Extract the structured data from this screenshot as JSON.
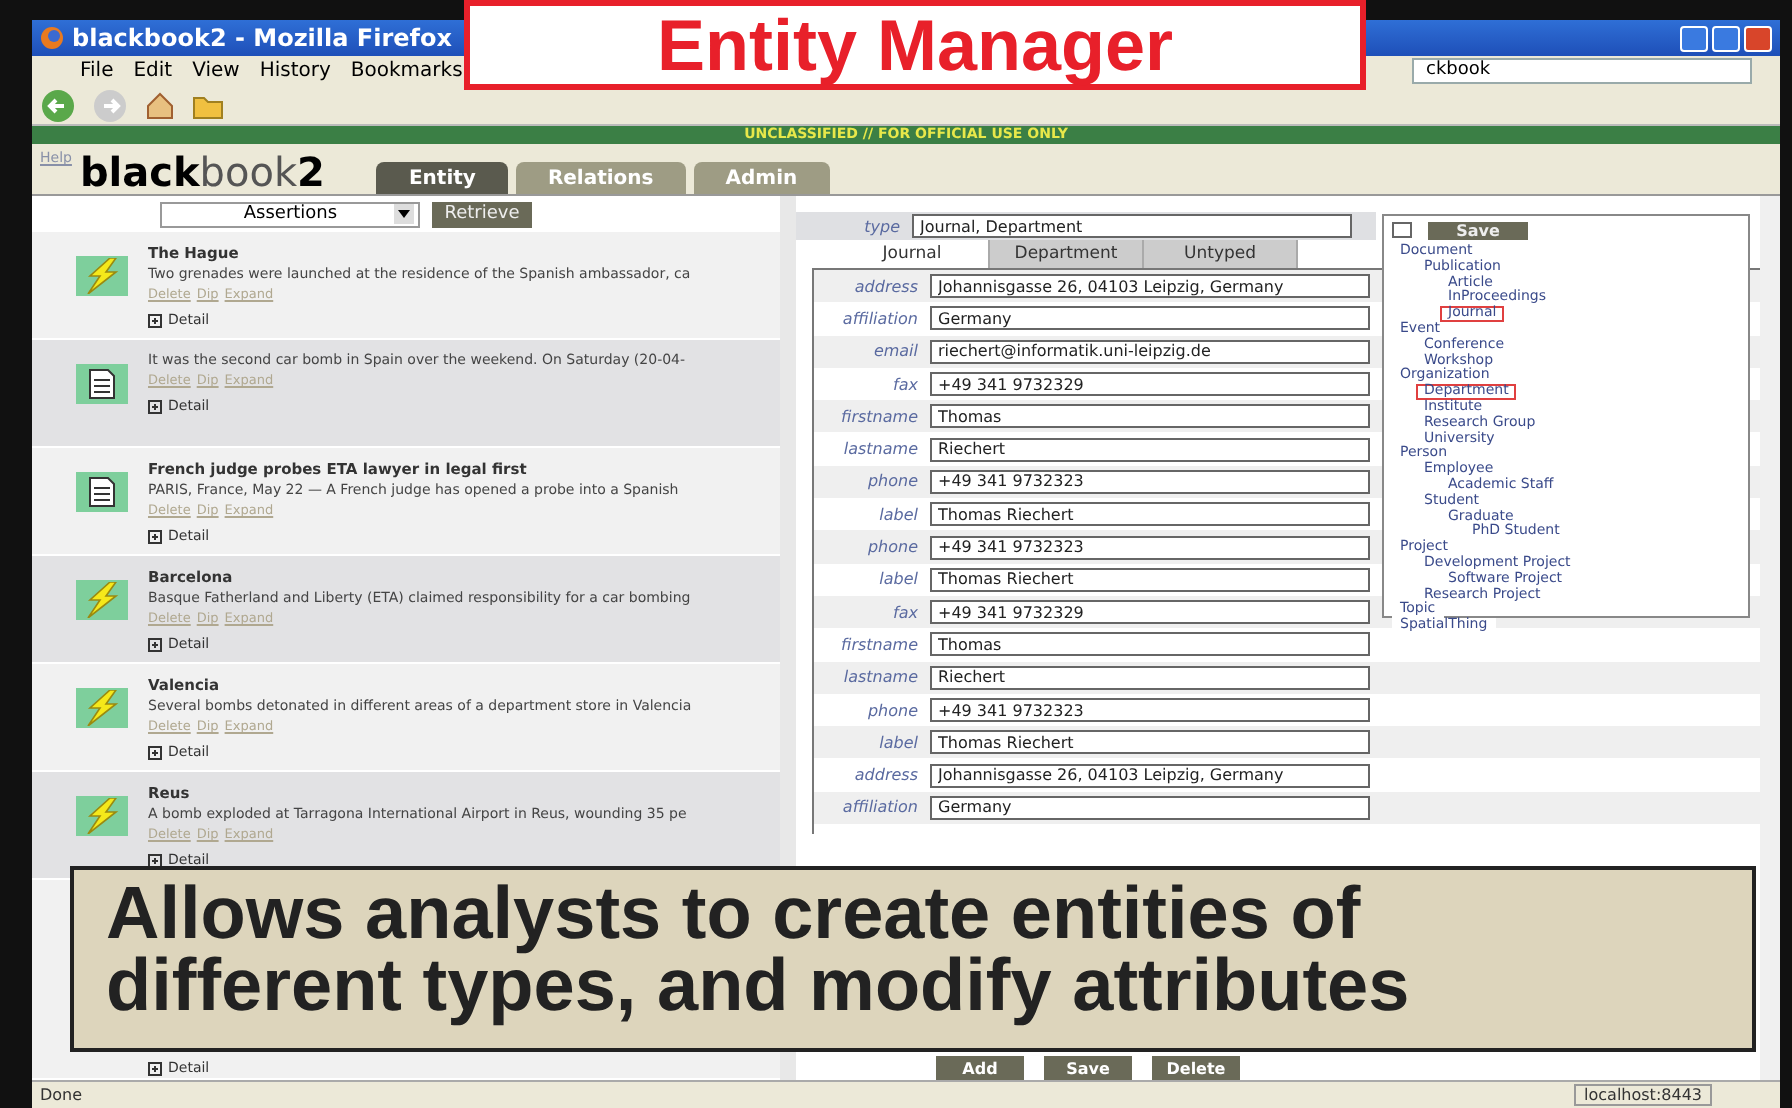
{
  "callout_title": "Entity Manager",
  "caption": "Allows analysts to create entities of different types, and modify attributes",
  "window": {
    "title": "blackbook2 - Mozilla Firefox"
  },
  "menu": [
    "File",
    "Edit",
    "View",
    "History",
    "Bookmarks"
  ],
  "address": "ckbook",
  "banner": "UNCLASSIFIED // FOR OFFICIAL USE ONLY",
  "app": {
    "help": "Help",
    "logo_bold": "black",
    "logo_light": "book",
    "logo_num": "2"
  },
  "tabs": [
    {
      "label": "Entity",
      "selected": true
    },
    {
      "label": "Relations",
      "selected": false
    },
    {
      "label": "Admin",
      "selected": false
    }
  ],
  "assertions": {
    "select": "Assertions",
    "button": "Retrieve",
    "items": [
      {
        "kind": "event",
        "title": "The Hague",
        "text": "Two grenades were launched at the residence of the Spanish ambassador, ca",
        "links": [
          "Delete",
          "Dip",
          "Expand"
        ],
        "detail": "Detail"
      },
      {
        "kind": "document",
        "text": "It was the second car bomb in Spain over the weekend. On Saturday (20-04-",
        "links": [
          "Delete",
          "Dip",
          "Expand"
        ],
        "detail": "Detail"
      },
      {
        "kind": "document",
        "title": "French judge probes ETA lawyer in legal first",
        "text": "PARIS, France, May 22 — A French judge has opened a probe into a Spanish",
        "links": [
          "Delete",
          "Dip",
          "Expand"
        ],
        "detail": "Detail"
      },
      {
        "kind": "event",
        "title": "Barcelona",
        "text": "Basque Fatherland and Liberty (ETA) claimed responsibility for a car bombing",
        "links": [
          "Delete",
          "Dip",
          "Expand"
        ],
        "detail": "Detail"
      },
      {
        "kind": "event",
        "title": "Valencia",
        "text": "Several bombs detonated in different areas of a department store in Valencia",
        "links": [
          "Delete",
          "Dip",
          "Expand"
        ],
        "detail": "Detail"
      },
      {
        "kind": "event",
        "title": "Reus",
        "text": "A bomb exploded at Tarragona International Airport in Reus, wounding 35 pe",
        "links": [
          "Delete",
          "Dip",
          "Expand"
        ],
        "detail": "Detail"
      },
      {
        "kind": "hidden",
        "detail": "Detail"
      }
    ]
  },
  "entity": {
    "type_label": "type",
    "type_value": "Journal, Department",
    "type_tabs": [
      {
        "label": "Journal",
        "selected": true
      },
      {
        "label": "Department",
        "selected": false
      },
      {
        "label": "Untyped",
        "selected": false
      }
    ],
    "fields": [
      {
        "label": "address",
        "value": "Johannisgasse 26, 04103 Leipzig, Germany"
      },
      {
        "label": "affiliation",
        "value": "Germany"
      },
      {
        "label": "email",
        "value": "riechert@informatik.uni-leipzig.de"
      },
      {
        "label": "fax",
        "value": "+49 341 9732329"
      },
      {
        "label": "firstname",
        "value": "Thomas"
      },
      {
        "label": "lastname",
        "value": "Riechert"
      },
      {
        "label": "phone",
        "value": "+49 341 9732323"
      },
      {
        "label": "label",
        "value": "Thomas Riechert"
      },
      {
        "label": "phone",
        "value": "+49 341 9732323"
      },
      {
        "label": "label",
        "value": "Thomas Riechert"
      },
      {
        "label": "fax",
        "value": "+49 341 9732329"
      },
      {
        "label": "firstname",
        "value": "Thomas"
      },
      {
        "label": "lastname",
        "value": "Riechert"
      },
      {
        "label": "phone",
        "value": "+49 341 9732323"
      },
      {
        "label": "label",
        "value": "Thomas Riechert"
      },
      {
        "label": "address",
        "value": "Johannisgasse 26, 04103 Leipzig, Germany"
      },
      {
        "label": "affiliation",
        "value": "Germany"
      }
    ],
    "buttons": [
      "Add",
      "Save",
      "Delete"
    ]
  },
  "type_tree": {
    "save": "Save",
    "items": [
      {
        "label": "Document",
        "selected": false,
        "children": [
          {
            "label": "Publication",
            "selected": false,
            "children": [
              {
                "label": "Article",
                "selected": false
              },
              {
                "label": "InProceedings",
                "selected": false
              },
              {
                "label": "Journal",
                "selected": true
              }
            ]
          }
        ]
      },
      {
        "label": "Event",
        "selected": false,
        "children": [
          {
            "label": "Conference",
            "selected": false
          },
          {
            "label": "Workshop",
            "selected": false
          }
        ]
      },
      {
        "label": "Organization",
        "selected": false,
        "children": [
          {
            "label": "Department",
            "selected": true
          },
          {
            "label": "Institute",
            "selected": false
          },
          {
            "label": "Research Group",
            "selected": false
          },
          {
            "label": "University",
            "selected": false
          }
        ]
      },
      {
        "label": "Person",
        "selected": false,
        "children": [
          {
            "label": "Employee",
            "selected": false,
            "children": [
              {
                "label": "Academic Staff",
                "selected": false
              }
            ]
          },
          {
            "label": "Student",
            "selected": false,
            "children": [
              {
                "label": "Graduate",
                "selected": false,
                "children": [
                  {
                    "label": "PhD Student",
                    "selected": false
                  }
                ]
              }
            ]
          }
        ]
      },
      {
        "label": "Project",
        "selected": false,
        "children": [
          {
            "label": "Development Project",
            "selected": false,
            "children": [
              {
                "label": "Software Project",
                "selected": false
              }
            ]
          },
          {
            "label": "Research Project",
            "selected": false
          }
        ]
      },
      {
        "label": "Topic",
        "selected": false
      },
      {
        "label": "SpatialThing",
        "selected": false
      }
    ]
  },
  "status": {
    "left": "Done",
    "right": "localhost:8443"
  }
}
